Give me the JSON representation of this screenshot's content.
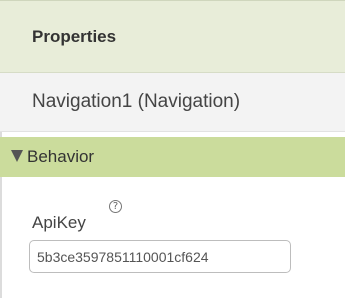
{
  "properties": {
    "title": "Properties",
    "component_name": "Navigation1 (Navigation)"
  },
  "section": {
    "label": "Behavior",
    "expanded": true,
    "color": "#cbdc9c"
  },
  "property": {
    "label": "ApiKey",
    "help_glyph": "?",
    "value": "5b3ce3597851110001cf624"
  },
  "colors": {
    "header_bg": "#e8edd9",
    "section_bg": "#cbdc9c"
  }
}
